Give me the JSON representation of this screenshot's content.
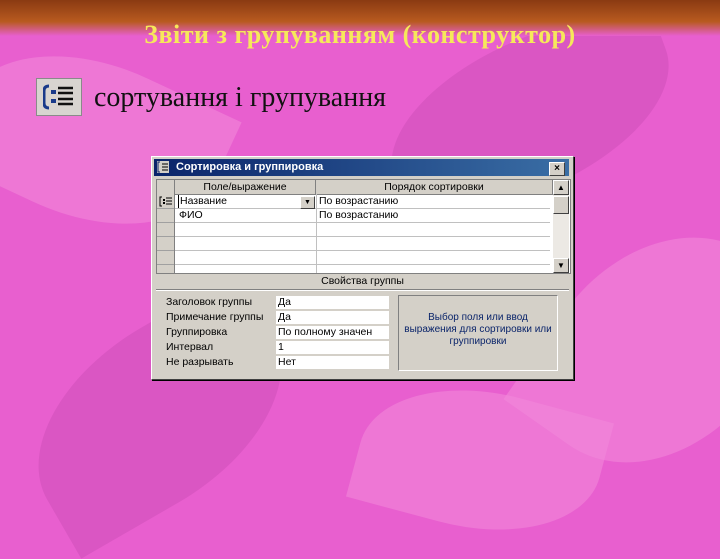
{
  "slide": {
    "title": "Звіти з групуванням (конструктор)",
    "subtitle": "сортування і групування"
  },
  "dialog": {
    "title": "Сортировка и группировка",
    "close_label": "×",
    "columns": [
      "Поле/выражение",
      "Порядок сортировки"
    ],
    "rows": [
      {
        "field": "Название",
        "order": "По возрастанию"
      },
      {
        "field": "ФИО",
        "order": "По возрастанию"
      }
    ],
    "properties_title": "Свойства группы",
    "properties": [
      {
        "label": "Заголовок группы",
        "value": "Да"
      },
      {
        "label": "Примечание группы",
        "value": "Да"
      },
      {
        "label": "Группировка",
        "value": "По полному значен"
      },
      {
        "label": "Интервал",
        "value": "1"
      },
      {
        "label": "Не разрывать",
        "value": "Нет"
      }
    ],
    "hint": "Выбор поля или ввод выражения для сортировки или группировки"
  },
  "colors": {
    "background": "#e85fcf",
    "title_color": "#f6e85a",
    "titlebar_start": "#0a246a",
    "titlebar_end": "#3a6ea5"
  },
  "icons": [
    "sorting-grouping-icon",
    "close-icon",
    "group-row-icon",
    "dropdown-arrow-icon",
    "scroll-up-icon",
    "scroll-down-icon"
  ]
}
